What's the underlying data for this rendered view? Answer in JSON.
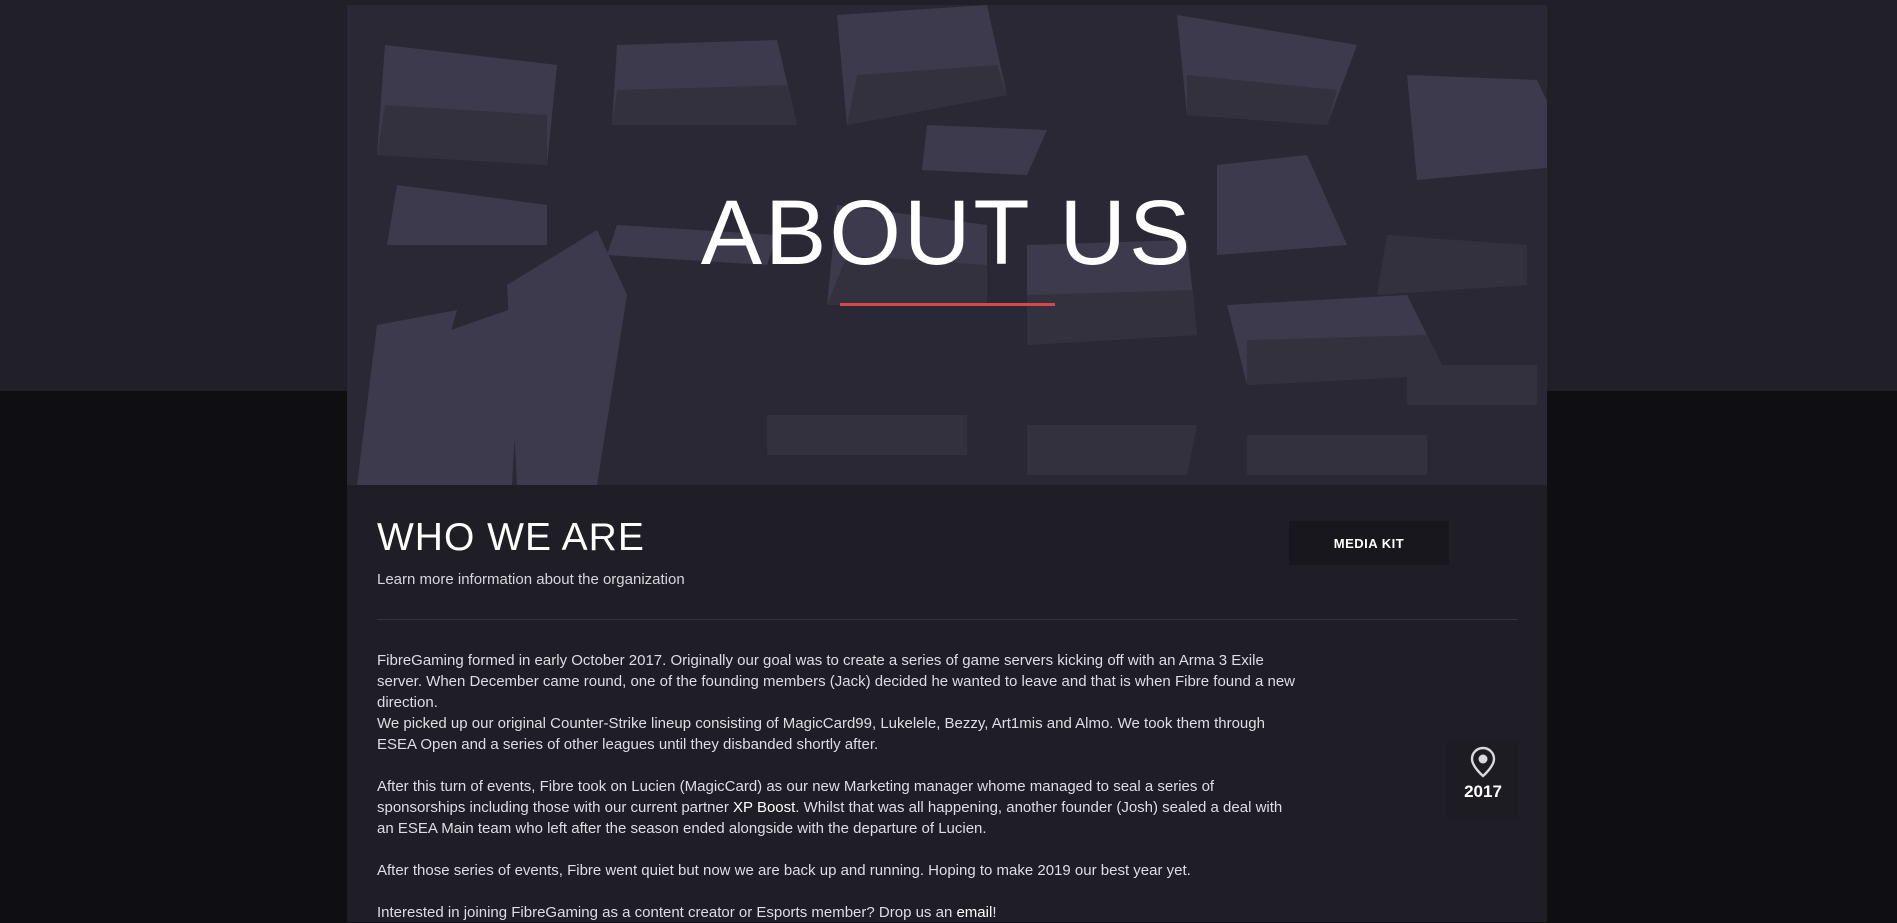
{
  "hero": {
    "title": "ABOUT US"
  },
  "section": {
    "title": "WHO WE ARE",
    "subtitle": "Learn more information about the organization",
    "media_kit_label": "MEDIA KIT"
  },
  "body": {
    "p1": "FibreGaming formed in early October 2017. Originally our goal was to create a series of game servers kicking off with an Arma 3 Exile server. When December came round, one of the founding members (Jack) decided he wanted to leave and that is when Fibre found a new direction.",
    "p2": "We picked up our original Counter-Strike lineup consisting of MagicCard99, Lukelele, Bezzy, Art1mis and Almo. We took them through ESEA Open and a series of other leagues until they disbanded shortly after.",
    "p3_before": "After this turn of events, Fibre took on Lucien (MagicCard) as our new Marketing manager whome managed to seal a series of sponsorships including those with our current partner ",
    "p3_link": "XP Boost",
    "p3_after": ". Whilst that was all happening, another founder (Josh) sealed a deal with an ESEA Main team who left after the season ended alongside with the departure of Lucien.",
    "p4": "After those series of events, Fibre went quiet but now we are back up and running. Hoping to make 2019 our best year yet.",
    "p5_before": "Interested in joining FibreGaming as a content creator or Esports member? Drop us an ",
    "p5_link": "email",
    "p5_after": "!"
  },
  "timeline": {
    "icon": "location-pin-icon",
    "year": "2017"
  },
  "colors": {
    "accent": "#d9474b",
    "hero_bg": "#2a2734",
    "content_bg": "#1f1e26",
    "page_bg": "#0f0f13"
  }
}
